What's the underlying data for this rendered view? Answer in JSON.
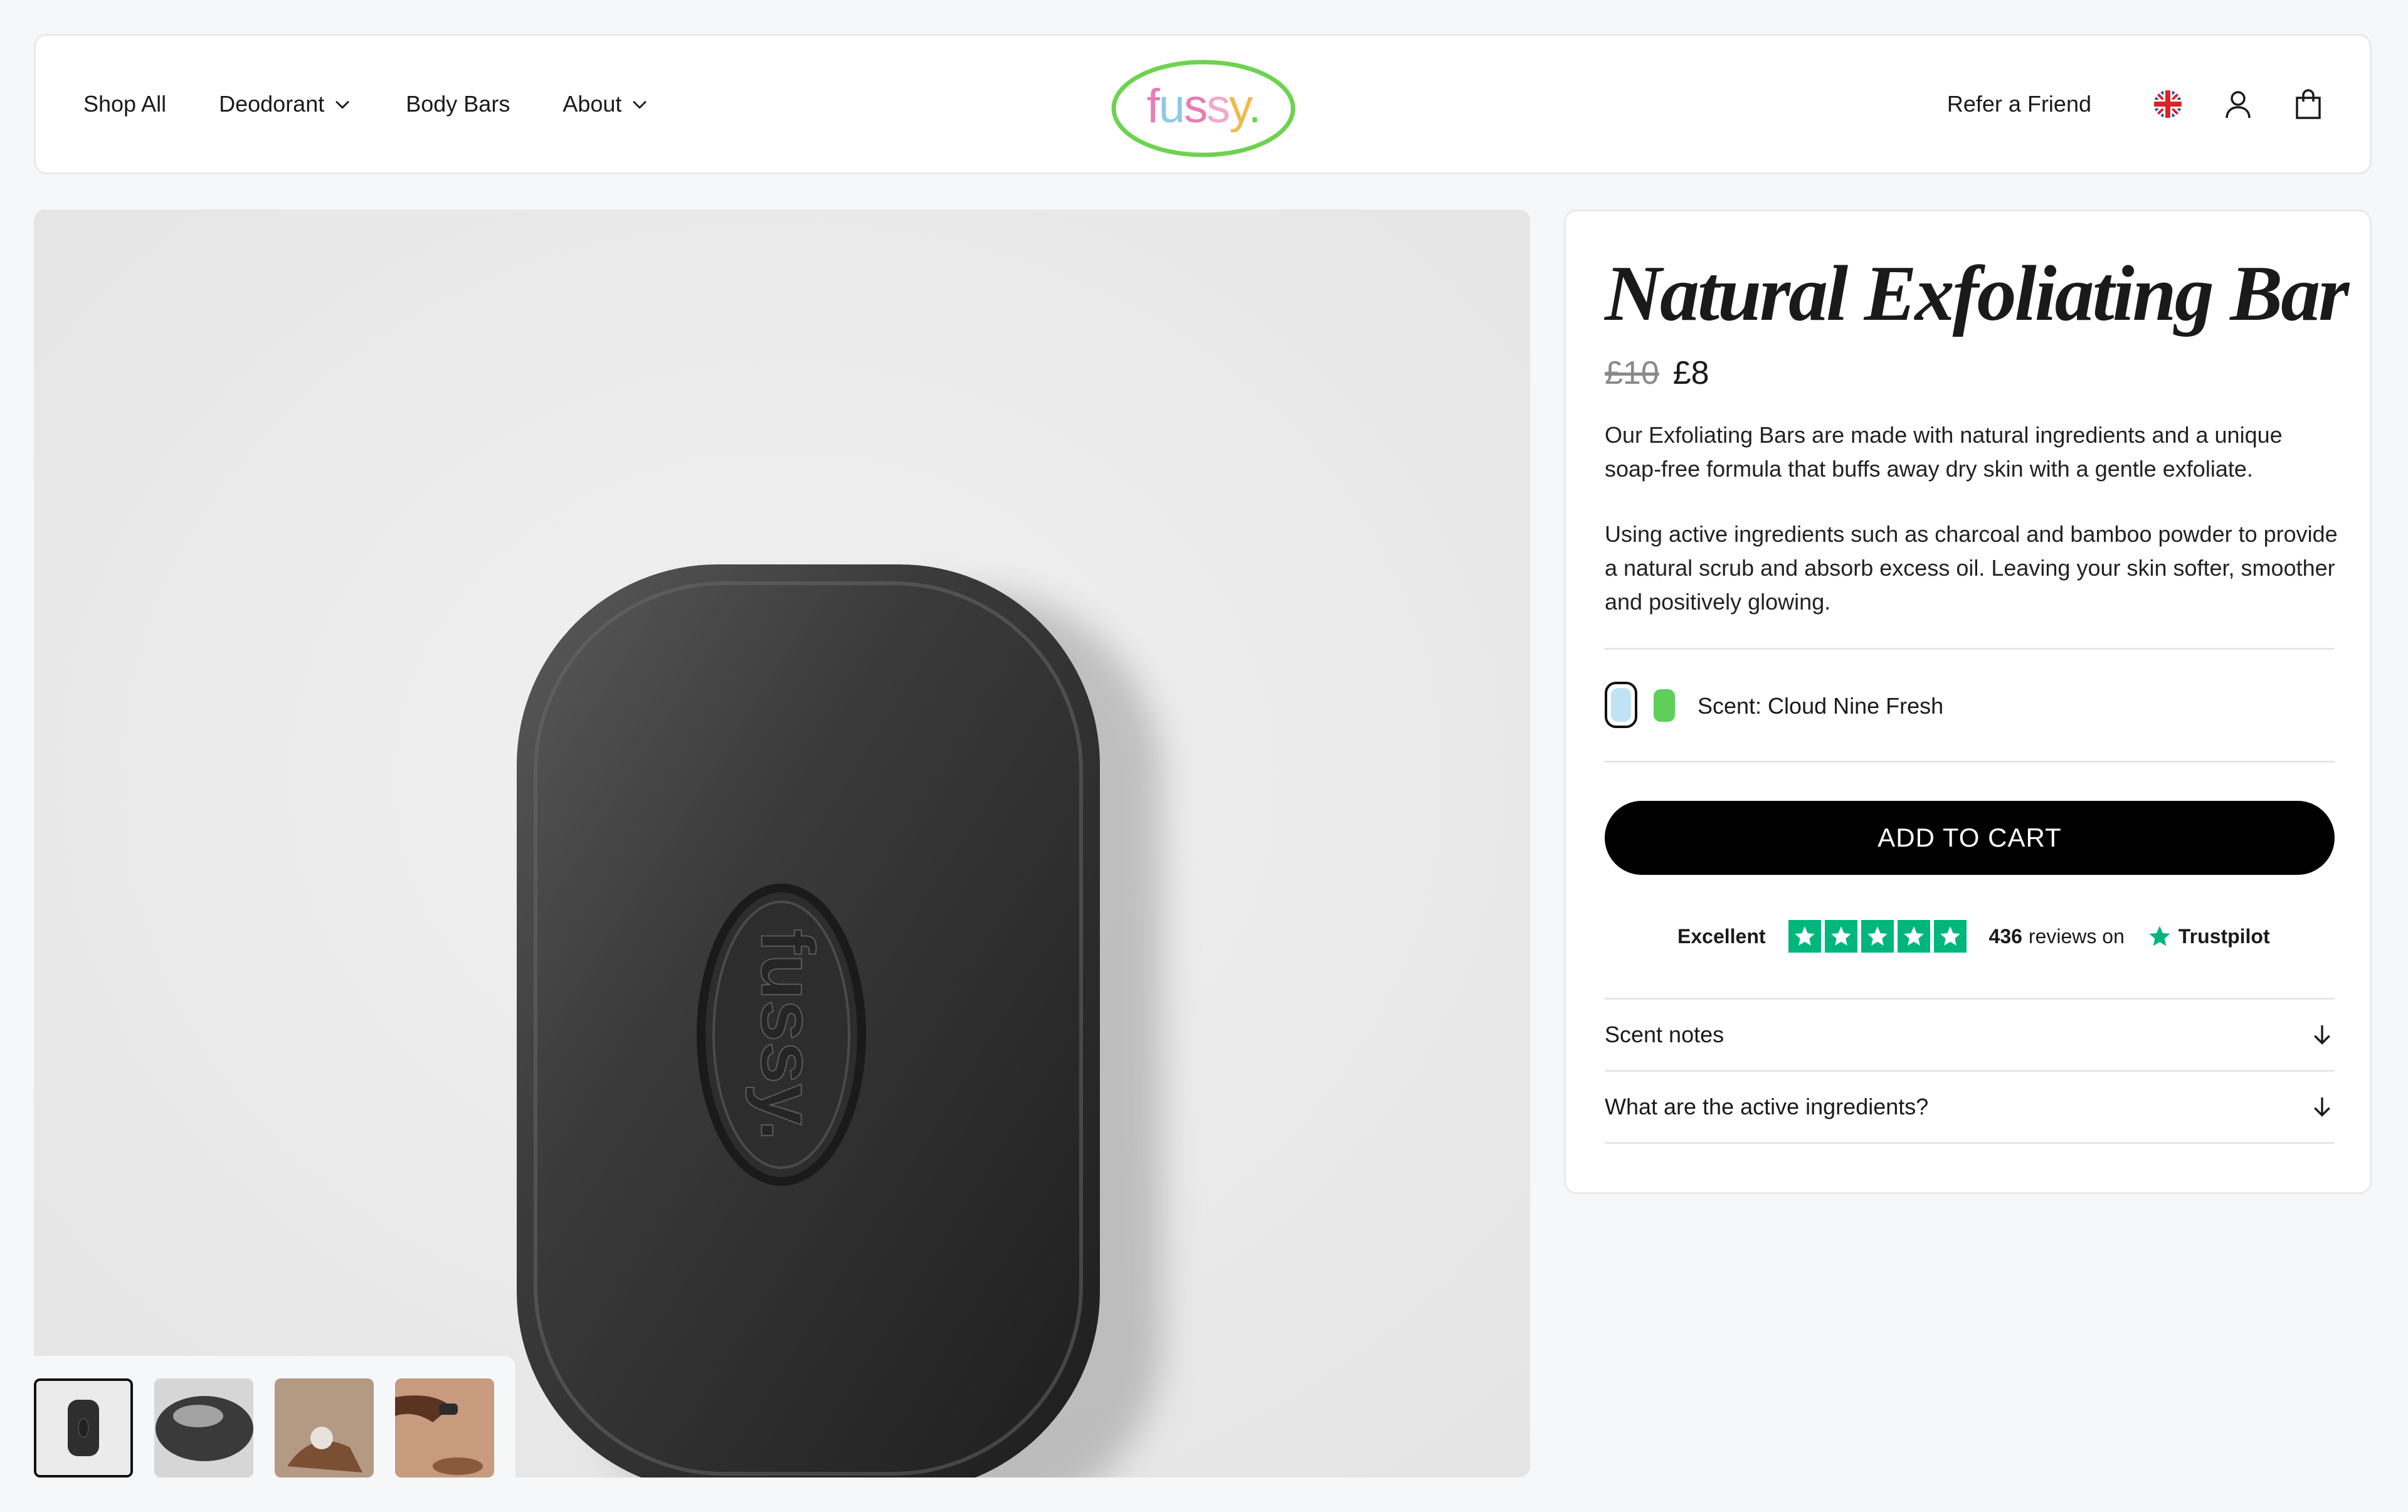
{
  "header": {
    "nav": [
      {
        "label": "Shop All",
        "has_menu": false
      },
      {
        "label": "Deodorant",
        "has_menu": true
      },
      {
        "label": "Body Bars",
        "has_menu": false
      },
      {
        "label": "About",
        "has_menu": true
      }
    ],
    "logo_text": "fussy.",
    "refer_label": "Refer a Friend",
    "icons": [
      "uk-flag-icon",
      "account-icon",
      "bag-icon"
    ]
  },
  "gallery": {
    "main_image": "charcoal-soap-bar",
    "embossed_text": "fussy.",
    "thumbnails": [
      "soap-bar-top-view",
      "soap-bar-lather",
      "hands-washing",
      "hand-holding-bar"
    ],
    "active_thumbnail": 0
  },
  "product": {
    "title": "Natural Exfoliating Bar",
    "old_price": "£10",
    "price": "£8",
    "description_1": "Our Exfoliating Bars are made with natural ingredients and a unique soap-free formula that buffs away dry skin with a gentle exfoliate.",
    "description_2": "Using active ingredients such as charcoal and bamboo powder to provide a natural scrub and absorb excess oil. Leaving your skin softer, smoother and positively glowing.",
    "scent_label": "Scent: Cloud Nine Fresh",
    "swatches": [
      {
        "color": "#bfe3f5",
        "selected": true
      },
      {
        "color": "#5fcf5a",
        "selected": false
      }
    ],
    "cart_label": "ADD TO CART",
    "trustpilot": {
      "rating_word": "Excellent",
      "stars": 5,
      "review_count": "436",
      "reviews_text": "reviews on",
      "brand": "Trustpilot"
    },
    "accordions": [
      "Scent notes",
      "What are the active ingredients?"
    ]
  },
  "colors": {
    "accent_green": "#00b67a",
    "logo_ring": "#6dd34f",
    "button": "#000000"
  }
}
